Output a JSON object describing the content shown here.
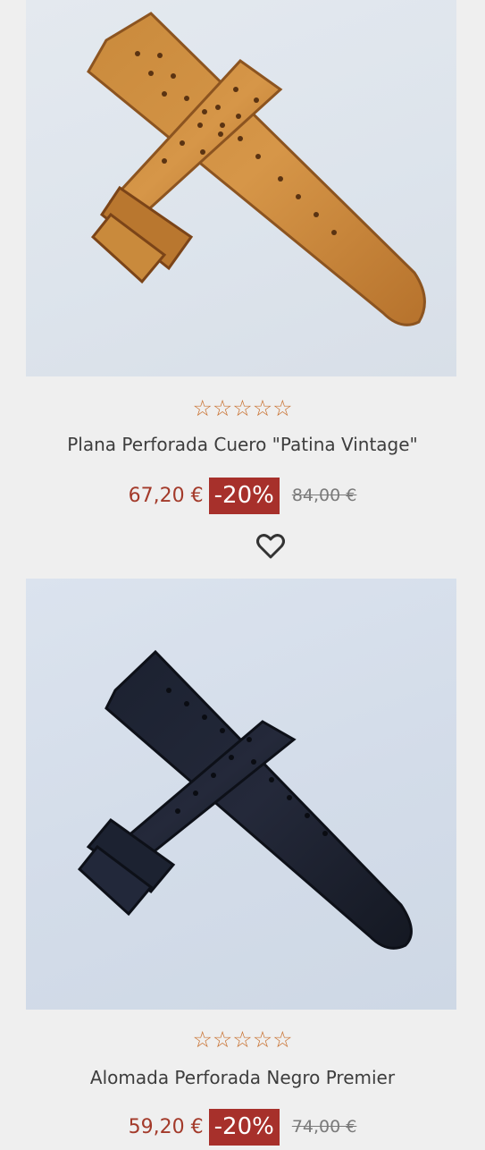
{
  "products": [
    {
      "image_alt": "Plana Perforada Cuero Patina Vintage strap",
      "rating_stars": "☆☆☆☆☆",
      "name": "Plana Perforada Cuero \"Patina Vintage\"",
      "price": "67,20 €",
      "discount": "-20%",
      "old_price": "84,00 €",
      "wishlist_icon": "heart-icon"
    },
    {
      "image_alt": "Alomada Perforada Negro Premier strap",
      "rating_stars": "☆☆☆☆☆",
      "name": "Alomada Perforada Negro Premier",
      "price": "59,20 €",
      "discount": "-20%",
      "old_price": "74,00 €"
    }
  ],
  "colors": {
    "price": "#a33a2a",
    "badge": "#a7302b",
    "stars": "#c8702f",
    "background": "#efefef"
  }
}
